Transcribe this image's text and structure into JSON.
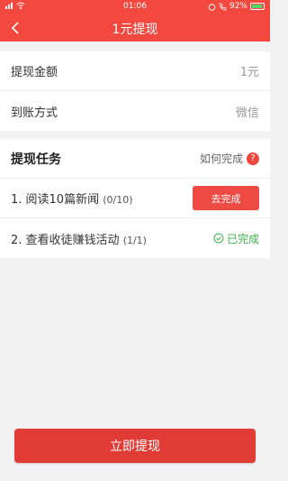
{
  "status_bar": {
    "time": "01:06",
    "battery": "92%"
  },
  "header": {
    "title": "1元提现"
  },
  "withdraw": {
    "amount_label": "提现金额",
    "amount_value": "1元",
    "method_label": "到账方式",
    "method_value": "微信"
  },
  "tasks": {
    "title": "提现任务",
    "howto_label": "如何完成",
    "howto_icon": "?",
    "items": [
      {
        "label": "1. 阅读10篇新闻",
        "progress": "(0/10)",
        "action_label": "去完成"
      },
      {
        "label": "2. 查看收徒赚钱活动",
        "progress": "(1/1)",
        "status_label": "已完成"
      }
    ]
  },
  "submit_label": "立即提现",
  "colors": {
    "brand_red": "#f2483f",
    "success_green": "#3db34a"
  }
}
